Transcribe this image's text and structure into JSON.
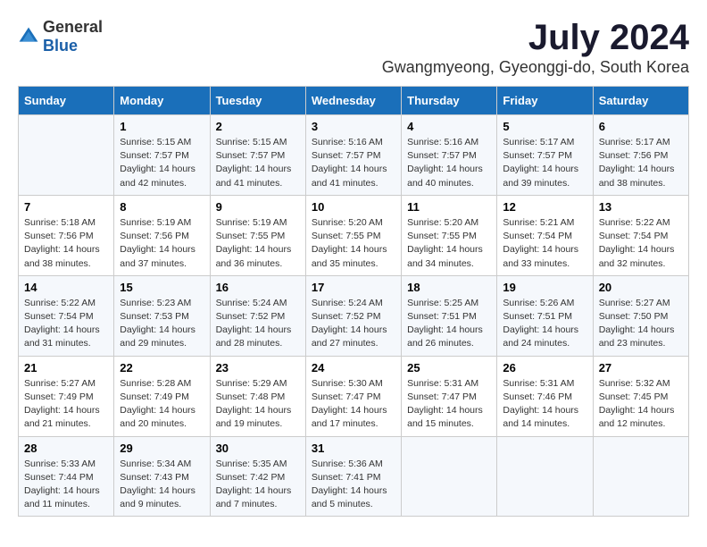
{
  "logo": {
    "general": "General",
    "blue": "Blue"
  },
  "title": "July 2024",
  "location": "Gwangmyeong, Gyeonggi-do, South Korea",
  "headers": [
    "Sunday",
    "Monday",
    "Tuesday",
    "Wednesday",
    "Thursday",
    "Friday",
    "Saturday"
  ],
  "weeks": [
    [
      {
        "day": "",
        "info": ""
      },
      {
        "day": "1",
        "info": "Sunrise: 5:15 AM\nSunset: 7:57 PM\nDaylight: 14 hours\nand 42 minutes."
      },
      {
        "day": "2",
        "info": "Sunrise: 5:15 AM\nSunset: 7:57 PM\nDaylight: 14 hours\nand 41 minutes."
      },
      {
        "day": "3",
        "info": "Sunrise: 5:16 AM\nSunset: 7:57 PM\nDaylight: 14 hours\nand 41 minutes."
      },
      {
        "day": "4",
        "info": "Sunrise: 5:16 AM\nSunset: 7:57 PM\nDaylight: 14 hours\nand 40 minutes."
      },
      {
        "day": "5",
        "info": "Sunrise: 5:17 AM\nSunset: 7:57 PM\nDaylight: 14 hours\nand 39 minutes."
      },
      {
        "day": "6",
        "info": "Sunrise: 5:17 AM\nSunset: 7:56 PM\nDaylight: 14 hours\nand 38 minutes."
      }
    ],
    [
      {
        "day": "7",
        "info": "Sunrise: 5:18 AM\nSunset: 7:56 PM\nDaylight: 14 hours\nand 38 minutes."
      },
      {
        "day": "8",
        "info": "Sunrise: 5:19 AM\nSunset: 7:56 PM\nDaylight: 14 hours\nand 37 minutes."
      },
      {
        "day": "9",
        "info": "Sunrise: 5:19 AM\nSunset: 7:55 PM\nDaylight: 14 hours\nand 36 minutes."
      },
      {
        "day": "10",
        "info": "Sunrise: 5:20 AM\nSunset: 7:55 PM\nDaylight: 14 hours\nand 35 minutes."
      },
      {
        "day": "11",
        "info": "Sunrise: 5:20 AM\nSunset: 7:55 PM\nDaylight: 14 hours\nand 34 minutes."
      },
      {
        "day": "12",
        "info": "Sunrise: 5:21 AM\nSunset: 7:54 PM\nDaylight: 14 hours\nand 33 minutes."
      },
      {
        "day": "13",
        "info": "Sunrise: 5:22 AM\nSunset: 7:54 PM\nDaylight: 14 hours\nand 32 minutes."
      }
    ],
    [
      {
        "day": "14",
        "info": "Sunrise: 5:22 AM\nSunset: 7:54 PM\nDaylight: 14 hours\nand 31 minutes."
      },
      {
        "day": "15",
        "info": "Sunrise: 5:23 AM\nSunset: 7:53 PM\nDaylight: 14 hours\nand 29 minutes."
      },
      {
        "day": "16",
        "info": "Sunrise: 5:24 AM\nSunset: 7:52 PM\nDaylight: 14 hours\nand 28 minutes."
      },
      {
        "day": "17",
        "info": "Sunrise: 5:24 AM\nSunset: 7:52 PM\nDaylight: 14 hours\nand 27 minutes."
      },
      {
        "day": "18",
        "info": "Sunrise: 5:25 AM\nSunset: 7:51 PM\nDaylight: 14 hours\nand 26 minutes."
      },
      {
        "day": "19",
        "info": "Sunrise: 5:26 AM\nSunset: 7:51 PM\nDaylight: 14 hours\nand 24 minutes."
      },
      {
        "day": "20",
        "info": "Sunrise: 5:27 AM\nSunset: 7:50 PM\nDaylight: 14 hours\nand 23 minutes."
      }
    ],
    [
      {
        "day": "21",
        "info": "Sunrise: 5:27 AM\nSunset: 7:49 PM\nDaylight: 14 hours\nand 21 minutes."
      },
      {
        "day": "22",
        "info": "Sunrise: 5:28 AM\nSunset: 7:49 PM\nDaylight: 14 hours\nand 20 minutes."
      },
      {
        "day": "23",
        "info": "Sunrise: 5:29 AM\nSunset: 7:48 PM\nDaylight: 14 hours\nand 19 minutes."
      },
      {
        "day": "24",
        "info": "Sunrise: 5:30 AM\nSunset: 7:47 PM\nDaylight: 14 hours\nand 17 minutes."
      },
      {
        "day": "25",
        "info": "Sunrise: 5:31 AM\nSunset: 7:47 PM\nDaylight: 14 hours\nand 15 minutes."
      },
      {
        "day": "26",
        "info": "Sunrise: 5:31 AM\nSunset: 7:46 PM\nDaylight: 14 hours\nand 14 minutes."
      },
      {
        "day": "27",
        "info": "Sunrise: 5:32 AM\nSunset: 7:45 PM\nDaylight: 14 hours\nand 12 minutes."
      }
    ],
    [
      {
        "day": "28",
        "info": "Sunrise: 5:33 AM\nSunset: 7:44 PM\nDaylight: 14 hours\nand 11 minutes."
      },
      {
        "day": "29",
        "info": "Sunrise: 5:34 AM\nSunset: 7:43 PM\nDaylight: 14 hours\nand 9 minutes."
      },
      {
        "day": "30",
        "info": "Sunrise: 5:35 AM\nSunset: 7:42 PM\nDaylight: 14 hours\nand 7 minutes."
      },
      {
        "day": "31",
        "info": "Sunrise: 5:36 AM\nSunset: 7:41 PM\nDaylight: 14 hours\nand 5 minutes."
      },
      {
        "day": "",
        "info": ""
      },
      {
        "day": "",
        "info": ""
      },
      {
        "day": "",
        "info": ""
      }
    ]
  ]
}
